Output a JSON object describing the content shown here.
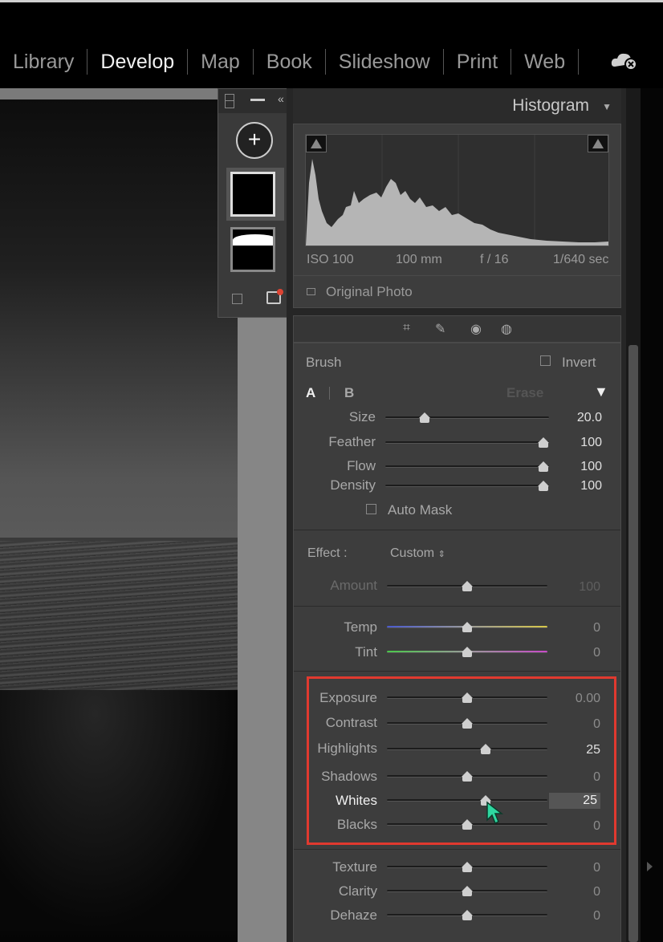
{
  "modules": [
    "Library",
    "Develop",
    "Map",
    "Book",
    "Slideshow",
    "Print",
    "Web"
  ],
  "active_module": "Develop",
  "histogram": {
    "title": "Histogram",
    "iso": "ISO 100",
    "focal": "100 mm",
    "aperture": "f / 16",
    "shutter": "1/640 sec",
    "original_photo": "Original Photo"
  },
  "mask_panel": {
    "add_symbol": "+",
    "collapse_symbol": "«"
  },
  "brush": {
    "title": "Brush",
    "invert": "Invert",
    "tab_a": "A",
    "tab_b": "B",
    "erase": "Erase",
    "auto_mask": "Auto Mask",
    "size": {
      "label": "Size",
      "value": "20.0",
      "position": 0.22
    },
    "feather": {
      "label": "Feather",
      "value": "100",
      "position": 1.0
    },
    "flow": {
      "label": "Flow",
      "value": "100",
      "position": 1.0
    },
    "density": {
      "label": "Density",
      "value": "100",
      "position": 1.0
    }
  },
  "effect": {
    "label": "Effect :",
    "preset": "Custom",
    "amount": {
      "label": "Amount",
      "value": "100",
      "position": 0.5
    }
  },
  "color": {
    "temp": {
      "label": "Temp",
      "value": "0",
      "position": 0.5
    },
    "tint": {
      "label": "Tint",
      "value": "0",
      "position": 0.5
    }
  },
  "tone": {
    "exposure": {
      "label": "Exposure",
      "value": "0.00",
      "position": 0.5
    },
    "contrast": {
      "label": "Contrast",
      "value": "0",
      "position": 0.5
    },
    "highlights": {
      "label": "Highlights",
      "value": "25",
      "position": 0.625
    },
    "shadows": {
      "label": "Shadows",
      "value": "0",
      "position": 0.5
    },
    "whites": {
      "label": "Whites",
      "value": "25",
      "position": 0.625
    },
    "blacks": {
      "label": "Blacks",
      "value": "0",
      "position": 0.5
    }
  },
  "presence": {
    "texture": {
      "label": "Texture",
      "value": "0",
      "position": 0.5
    },
    "clarity": {
      "label": "Clarity",
      "value": "0",
      "position": 0.5
    },
    "dehaze": {
      "label": "Dehaze",
      "value": "0",
      "position": 0.5
    }
  },
  "colors": {
    "highlight_box": "#e0392f",
    "cursor": "#2fd6a0"
  }
}
